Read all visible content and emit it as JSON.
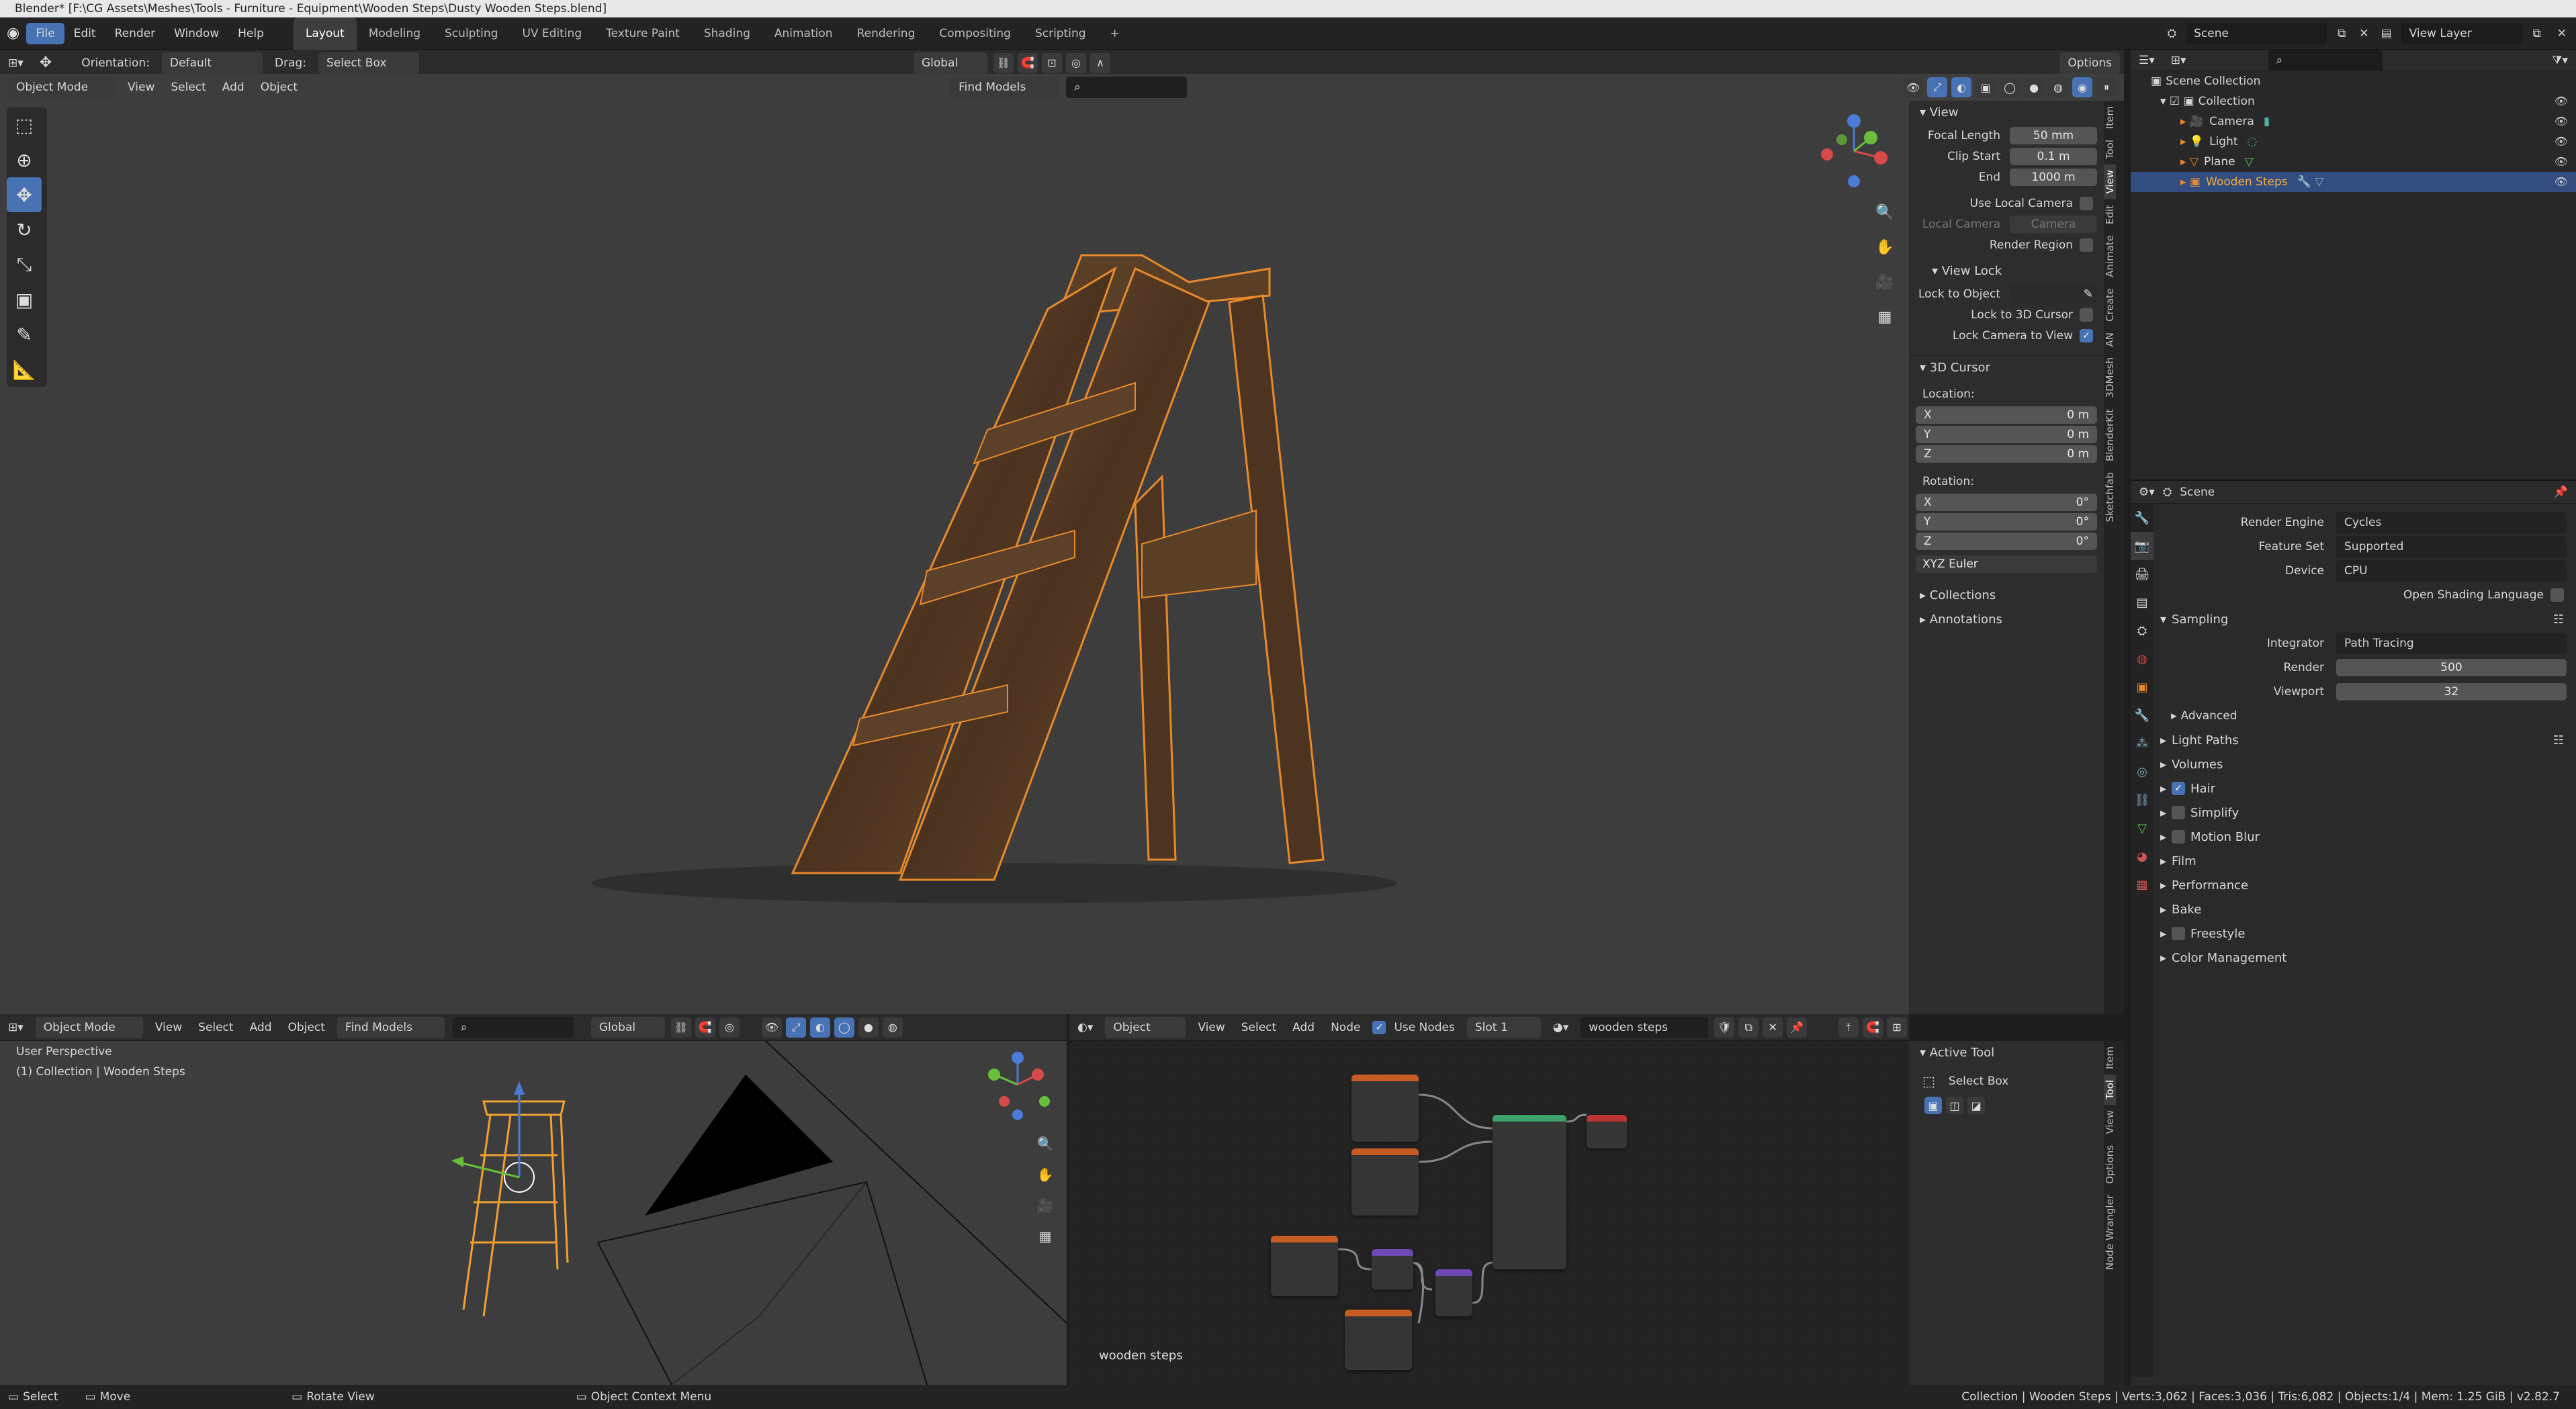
{
  "window": {
    "title": "Blender* [F:\\CG Assets\\Meshes\\Tools - Furniture - Equipment\\Wooden Steps\\Dusty Wooden Steps.blend]"
  },
  "menu": [
    "File",
    "Edit",
    "Render",
    "Window",
    "Help"
  ],
  "workspaces": [
    "Layout",
    "Modeling",
    "Sculpting",
    "UV Editing",
    "Texture Paint",
    "Shading",
    "Animation",
    "Rendering",
    "Compositing",
    "Scripting"
  ],
  "scene": {
    "label": "Scene",
    "view_layer": "View Layer"
  },
  "tool_header": {
    "orientation_label": "Orientation:",
    "orientation_value": "Default",
    "drag_label": "Drag:",
    "drag_value": "Select Box",
    "transform": "Global",
    "options": "Options"
  },
  "viewport_header": {
    "mode": "Object Mode",
    "menus": [
      "View",
      "Select",
      "Add",
      "Object"
    ],
    "find_models": "Find Models"
  },
  "npanel": {
    "view_title": "View",
    "focal_length": {
      "label": "Focal Length",
      "value": "50 mm"
    },
    "clip_start": {
      "label": "Clip Start",
      "value": "0.1 m"
    },
    "clip_end": {
      "label": "End",
      "value": "1000 m"
    },
    "use_local_camera": "Use Local Camera",
    "local_camera": {
      "label": "Local Camera",
      "value": "Camera"
    },
    "render_region": "Render Region",
    "view_lock": "View Lock",
    "lock_to_object": "Lock to Object",
    "lock_to_3d_cursor": "Lock to 3D Cursor",
    "lock_camera_to_view": "Lock Camera to View",
    "cursor_title": "3D Cursor",
    "location_label": "Location:",
    "location": [
      {
        "axis": "X",
        "value": "0 m"
      },
      {
        "axis": "Y",
        "value": "0 m"
      },
      {
        "axis": "Z",
        "value": "0 m"
      }
    ],
    "rotation_label": "Rotation:",
    "rotation": [
      {
        "axis": "X",
        "value": "0°"
      },
      {
        "axis": "Y",
        "value": "0°"
      },
      {
        "axis": "Z",
        "value": "0°"
      }
    ],
    "rotation_mode": "XYZ Euler",
    "collections": "Collections",
    "annotations": "Annotations",
    "tabs": [
      "Item",
      "Tool",
      "View",
      "Edit",
      "Animate",
      "Create",
      "AN",
      "3DMesh",
      "BlenderKit",
      "Sketchfab"
    ]
  },
  "outliner": {
    "root": "Scene Collection",
    "collection": "Collection",
    "items": [
      "Camera",
      "Light",
      "Plane",
      "Wooden Steps"
    ]
  },
  "properties": {
    "scene": "Scene",
    "render_engine": {
      "label": "Render Engine",
      "value": "Cycles"
    },
    "feature_set": {
      "label": "Feature Set",
      "value": "Supported"
    },
    "device": {
      "label": "Device",
      "value": "CPU"
    },
    "osl": "Open Shading Language",
    "sampling": "Sampling",
    "integrator": {
      "label": "Integrator",
      "value": "Path Tracing"
    },
    "render": {
      "label": "Render",
      "value": "500"
    },
    "viewport": {
      "label": "Viewport",
      "value": "32"
    },
    "advanced": "Advanced",
    "sections": [
      "Light Paths",
      "Volumes",
      "Hair",
      "Simplify",
      "Motion Blur",
      "Film",
      "Performance",
      "Bake",
      "Freestyle",
      "Color Management"
    ]
  },
  "bottom_viewport": {
    "mode": "Object Mode",
    "menus": [
      "View",
      "Select",
      "Add",
      "Object"
    ],
    "find_models": "Find Models",
    "transform": "Global",
    "perspective": "User Perspective",
    "collection_info": "(1) Collection | Wooden Steps"
  },
  "node_editor": {
    "type": "Object",
    "menus": [
      "View",
      "Select",
      "Add",
      "Node"
    ],
    "use_nodes": "Use Nodes",
    "slot": "Slot 1",
    "material": "wooden steps",
    "label": "wooden steps"
  },
  "active_tool": {
    "title": "Active Tool",
    "tool": "Select Box",
    "tabs": [
      "Item",
      "Tool",
      "View",
      "Options",
      "Node Wrangler"
    ]
  },
  "status": {
    "select": "Select",
    "move": "Move",
    "rotate": "Rotate View",
    "context": "Object Context Menu",
    "info": "Collection | Wooden Steps | Verts:3,062 | Faces:3,036 | Tris:6,082 | Objects:1/4 | Mem: 1.25 GiB | v2.82.7"
  },
  "colors": {
    "accent": "#4772b3",
    "selected_outline": "#e8892a",
    "viewport_bg": "#3d3d3d"
  }
}
